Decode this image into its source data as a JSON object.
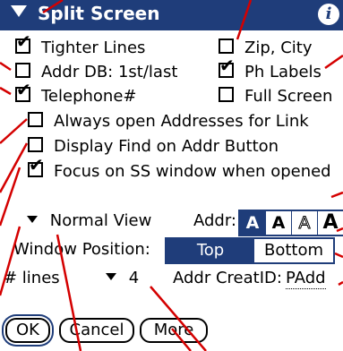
{
  "title": {
    "text": "Split Screen",
    "info_icon": "info-icon"
  },
  "options": [
    {
      "label": "Tighter Lines",
      "checked": true
    },
    {
      "label": "Zip, City",
      "checked": false
    },
    {
      "label": "Addr DB: 1st/last",
      "checked": false
    },
    {
      "label": "Ph Labels",
      "checked": true
    },
    {
      "label": "Telephone#",
      "checked": true
    },
    {
      "label": "Full Screen",
      "checked": false
    },
    {
      "label": "Always open Addresses for Link",
      "checked": false
    },
    {
      "label": "Display Find on Addr Button",
      "checked": false
    },
    {
      "label": "Focus on SS window when opened",
      "checked": true
    }
  ],
  "view": {
    "value": "Normal View"
  },
  "addr_font": {
    "label": "Addr:",
    "fonts": [
      "A",
      "A",
      "A",
      "A"
    ],
    "selected": 0
  },
  "window_position": {
    "label": "Window Position:",
    "options": [
      "Top",
      "Bottom"
    ],
    "selected": "Top"
  },
  "lines": {
    "label": "# lines",
    "value": "4"
  },
  "creator": {
    "label": "Addr CreatID:",
    "value": "PAdd"
  },
  "buttons": {
    "ok": "OK",
    "cancel": "Cancel",
    "more": "More"
  },
  "colors": {
    "accent": "#1f3d7a",
    "annotation": "#d40000"
  }
}
